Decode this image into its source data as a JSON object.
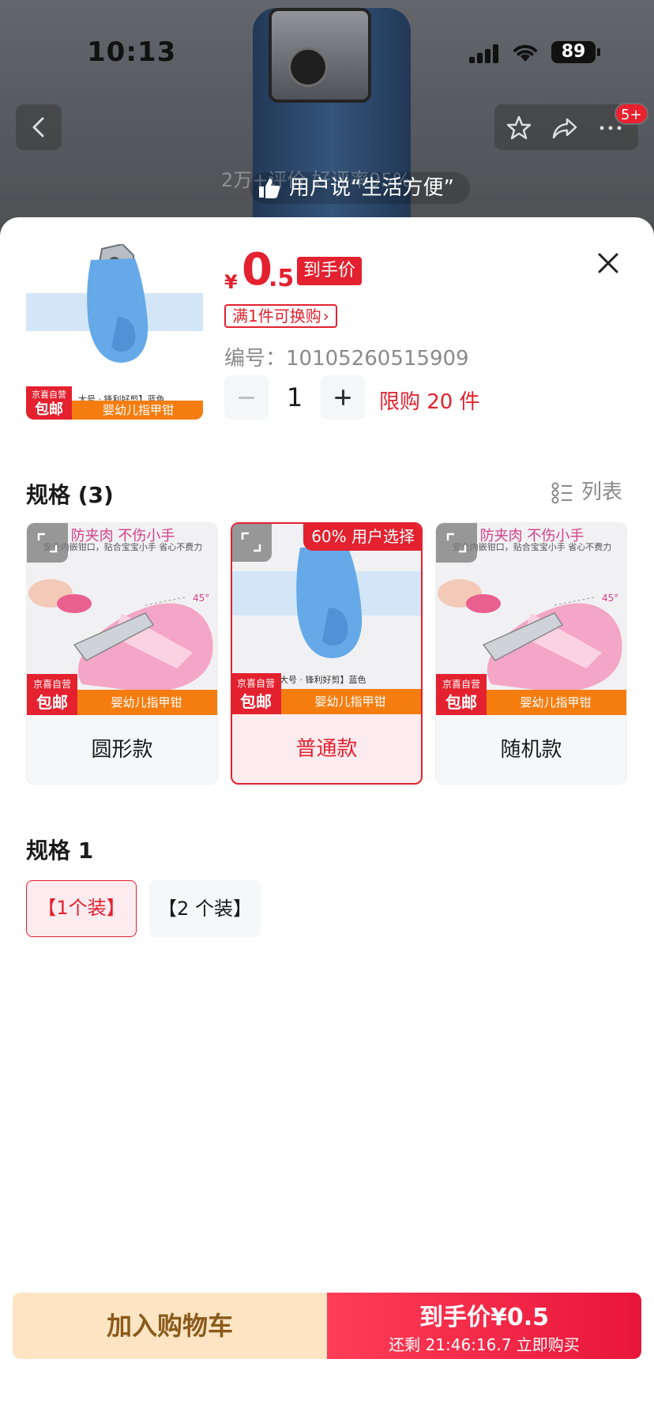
{
  "status_bar": {
    "time": "10:13",
    "battery": "89"
  },
  "background": {
    "cart_badge": "5+",
    "review_ghost": "2万+评价 好评率95%",
    "review_text": "用户说“生活方便”"
  },
  "product": {
    "price_symbol": "¥",
    "price_int": "0",
    "price_dec": ".5",
    "price_tag": "到手价",
    "promo_tag": "满1件可换购",
    "sku_code": "编号：10105260515909",
    "quantity": "1",
    "limit": "限购 20 件",
    "thumb_caption": "大号 · 锋利好剪】蓝色",
    "thumb_footer": "婴幼儿指甲钳",
    "jd_line1": "京喜自营",
    "jd_line2": "包邮"
  },
  "spec_section": {
    "title": "规格 (3)",
    "list_toggle": "列表",
    "cards": [
      {
        "label": "圆形款",
        "pink_title": "防夹肉 不伤小手",
        "pink_sub": "安全内嵌钳口，贴合宝宝小手 省心不费力",
        "footer": "婴幼儿指甲钳",
        "angle": "45°",
        "selected": false
      },
      {
        "label": "普通款",
        "badge": "60% 用户选择",
        "caption": "大号 · 锋利好剪】蓝色",
        "footer": "婴幼儿指甲钳",
        "selected": true
      },
      {
        "label": "随机款",
        "pink_title": "防夹肉 不伤小手",
        "pink_sub": "安全内嵌钳口，贴合宝宝小手 省心不费力",
        "footer": "婴幼儿指甲钳",
        "angle": "45°",
        "selected": false
      }
    ]
  },
  "spec1_section": {
    "title": "规格 1",
    "options": [
      {
        "label": "【1个装】",
        "selected": true
      },
      {
        "label": "【2 个装】",
        "selected": false
      }
    ]
  },
  "bottom_bar": {
    "cart_label": "加入购物车",
    "buy_main": "到手价¥0.5",
    "buy_sub": "还剩 21:46:16.7 立即购买"
  },
  "colors": {
    "accent": "#e3212f",
    "cart_bg": "#fde5c3",
    "cart_text": "#8a5a1b"
  }
}
